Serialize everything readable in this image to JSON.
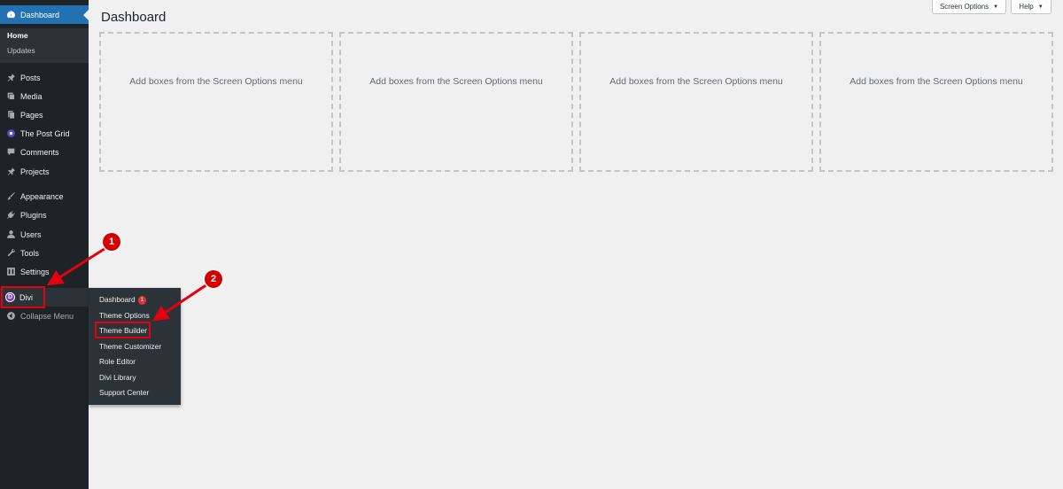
{
  "sidebar": {
    "dashboard": {
      "label": "Dashboard",
      "icon": "dashboard-icon"
    },
    "submenu": [
      {
        "label": "Home"
      },
      {
        "label": "Updates"
      }
    ],
    "items": [
      {
        "label": "Posts",
        "icon": "pin-icon"
      },
      {
        "label": "Media",
        "icon": "media-icon"
      },
      {
        "label": "Pages",
        "icon": "pages-icon"
      },
      {
        "label": "The Post Grid",
        "icon": "grid-icon"
      },
      {
        "label": "Comments",
        "icon": "comment-icon"
      },
      {
        "label": "Projects",
        "icon": "pin-icon"
      },
      {
        "label": "Appearance",
        "icon": "brush-icon"
      },
      {
        "label": "Plugins",
        "icon": "plug-icon"
      },
      {
        "label": "Users",
        "icon": "user-icon"
      },
      {
        "label": "Tools",
        "icon": "wrench-icon"
      },
      {
        "label": "Settings",
        "icon": "settings-icon"
      }
    ],
    "divi": {
      "label": "Divi",
      "logo_letter": "D"
    },
    "collapse": {
      "label": "Collapse Menu"
    }
  },
  "flyout": {
    "items": [
      {
        "label": "Dashboard",
        "badge": "1"
      },
      {
        "label": "Theme Options"
      },
      {
        "label": "Theme Builder"
      },
      {
        "label": "Theme Customizer"
      },
      {
        "label": "Role Editor"
      },
      {
        "label": "Divi Library"
      },
      {
        "label": "Support Center"
      }
    ]
  },
  "header": {
    "title": "Dashboard",
    "screen_options": "Screen Options",
    "help": "Help"
  },
  "boxes": [
    {
      "text": "Add boxes from the Screen Options menu"
    },
    {
      "text": "Add boxes from the Screen Options menu"
    },
    {
      "text": "Add boxes from the Screen Options menu"
    },
    {
      "text": "Add boxes from the Screen Options menu"
    }
  ],
  "annotations": [
    {
      "number": "1"
    },
    {
      "number": "2"
    }
  ],
  "colors": {
    "sidebar_bg": "#1d2327",
    "accent": "#2271b1",
    "annotation_red": "#e3000f",
    "badge_red": "#d63638"
  }
}
